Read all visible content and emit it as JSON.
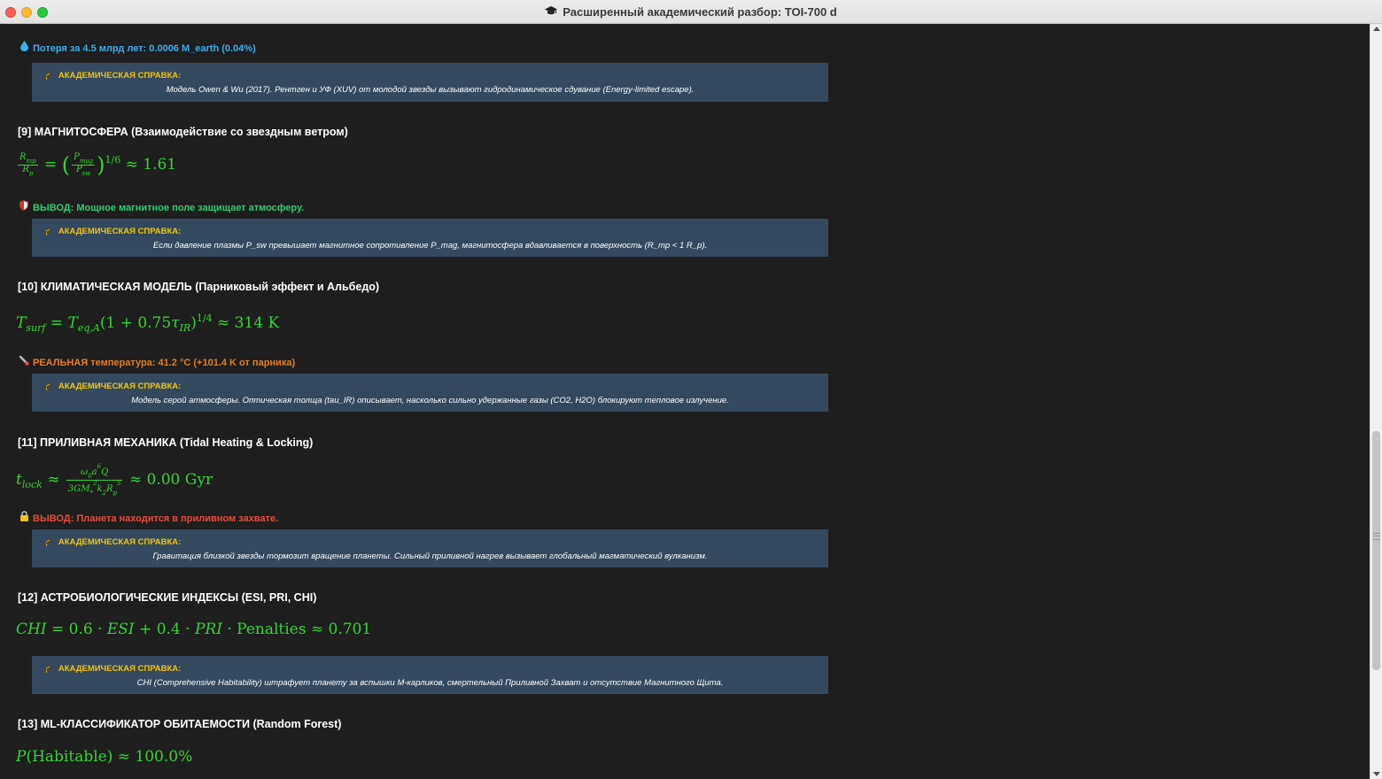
{
  "window": {
    "title": "Расширенный академический разбор: TOI-700 d",
    "title_icon": "graduation-cap-icon"
  },
  "colors": {
    "background": "#1e1e1e",
    "ref_box": "#34495e",
    "ref_title": "#f1c40f",
    "formula": "#33d633",
    "blue": "#3daee9",
    "green": "#2ecc71",
    "orange": "#e67e22",
    "red": "#e74c3c"
  },
  "top_line": {
    "icon": "droplet-icon",
    "text": "Потеря за 4.5 млрд лет: 0.0006 M_earth (0.04%)"
  },
  "ref_title": "АКАДЕМИЧЕСКАЯ СПРАВКА:",
  "refs": [
    "Модель Owen & Wu (2017). Рентген и УФ (XUV) от молодой звезды вызывают гидродинамическое сдувание (Energy-limited escape).",
    "Если давление плазмы P_sw превышает магнитное сопротивление P_mag, магнитосфера вдавливается в поверхность (R_mp < 1 R_p).",
    "Модель серой атмосферы. Оптическая толща (tau_IR) описывает, насколько сильно удержанные газы (CO2, H2O) блокируют тепловое излучение.",
    "Гравитация близкой звезды тормозит вращение планеты. Сильный приливной нагрев вызывает глобальный магматический вулканизм.",
    "CHI (Comprehensive Habitability) штрафует планету за вспышки М-карликов, смертельный Приливной Захват и отсутствие Магнитного Щита."
  ],
  "sections": {
    "s9": {
      "heading": "[9] МАГНИТОСФЕРА (Взаимодействие со звездным ветром)",
      "result": "≈ 1.61",
      "conclusion_icon": "shield-icon",
      "conclusion": "ВЫВОД: Мощное магнитное поле защищает атмосферу."
    },
    "s10": {
      "heading": "[10] КЛИМАТИЧЕСКАЯ МОДЕЛЬ (Парниковый эффект и Альбедо)",
      "result": "≈ 314 K",
      "conclusion_icon": "thermometer-icon",
      "conclusion": "РЕАЛЬНАЯ температура: 41.2 °C (+101.4 K от парника)"
    },
    "s11": {
      "heading": "[11] ПРИЛИВНАЯ МЕХАНИКА (Tidal Heating & Locking)",
      "result": "≈ 0.00 Gyr",
      "conclusion_icon": "lock-icon",
      "conclusion": "ВЫВОД: Планета находится в приливном захвате."
    },
    "s12": {
      "heading": "[12] АСТРОБИОЛОГИЧЕСКИЕ ИНДЕКСЫ (ESI, PRI, CHI)",
      "result": "≈ 0.701"
    },
    "s13": {
      "heading": "[13] ML-КЛАССИФИКАТОР ОБИТАЕМОСТИ (Random Forest)",
      "result": "≈ 100.0%"
    }
  }
}
